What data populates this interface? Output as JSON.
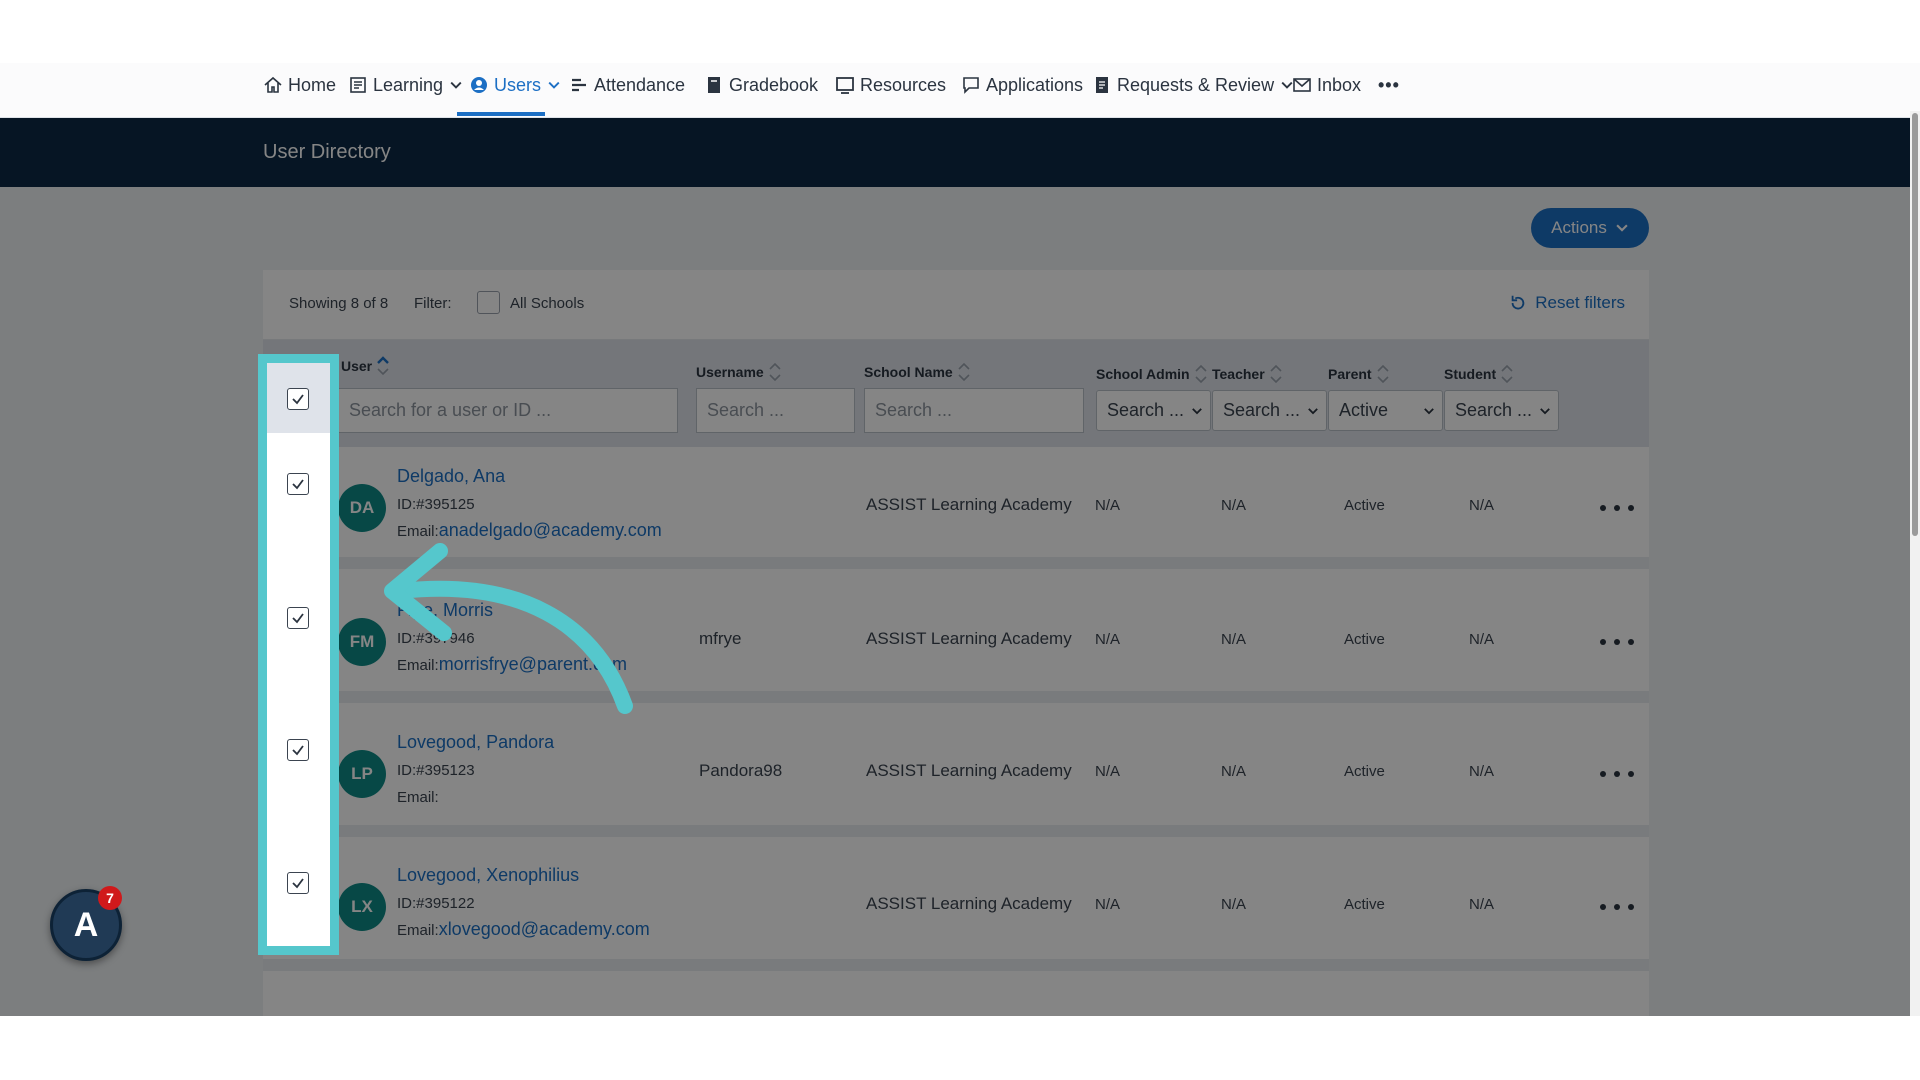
{
  "nav": {
    "items": [
      {
        "label": "Home",
        "icon": "home-icon"
      },
      {
        "label": "Learning",
        "icon": "learning-icon"
      },
      {
        "label": "Users",
        "icon": "user-icon"
      },
      {
        "label": "Attendance",
        "icon": "attendance-icon"
      },
      {
        "label": "Gradebook",
        "icon": "gradebook-icon"
      },
      {
        "label": "Resources",
        "icon": "resources-icon"
      },
      {
        "label": "Applications",
        "icon": "applications-icon"
      },
      {
        "label": "Requests & Review",
        "icon": "requests-icon"
      },
      {
        "label": "Inbox",
        "icon": "inbox-icon"
      }
    ],
    "more_label": "•••",
    "active": "Users"
  },
  "page": {
    "title": "User Directory"
  },
  "actions_label": "Actions",
  "filterbar": {
    "showing": "Showing 8 of 8",
    "filter_label": "Filter:",
    "all_schools": "All Schools",
    "reset": "Reset filters"
  },
  "table": {
    "columns": {
      "user": "User",
      "username": "Username",
      "school": "School Name",
      "school_admin": "School Admin",
      "teacher": "Teacher",
      "parent": "Parent",
      "student": "Student"
    },
    "search": {
      "user_placeholder": "Search for a user or ID ...",
      "username_placeholder": "Search ...",
      "school_placeholder": "Search ...",
      "school_admin": "Search ...",
      "teacher": "Search ...",
      "parent": "Active",
      "student": "Search ..."
    },
    "rows": [
      {
        "initials": "DA",
        "name": "Delgado, Ana",
        "id": "ID:#395125",
        "email_label": "Email:",
        "email": "anadelgado@academy.com",
        "username": "",
        "school": "ASSIST Learning Academy",
        "school_admin": "N/A",
        "teacher": "N/A",
        "parent": "Active",
        "student": "N/A",
        "checked": true
      },
      {
        "initials": "FM",
        "name": "Frye, Morris",
        "id": "ID:#397946",
        "email_label": "Email:",
        "email": "morrisfrye@parent.com",
        "username": "mfrye",
        "school": "ASSIST Learning Academy",
        "school_admin": "N/A",
        "teacher": "N/A",
        "parent": "Active",
        "student": "N/A",
        "checked": true
      },
      {
        "initials": "LP",
        "name": "Lovegood, Pandora",
        "id": "ID:#395123",
        "email_label": "Email:",
        "email": "",
        "username": "Pandora98",
        "school": "ASSIST Learning Academy",
        "school_admin": "N/A",
        "teacher": "N/A",
        "parent": "Active",
        "student": "N/A",
        "checked": true
      },
      {
        "initials": "LX",
        "name": "Lovegood, Xenophilius",
        "id": "ID:#395122",
        "email_label": "Email:",
        "email": "xlovegood@academy.com",
        "username": "",
        "school": "ASSIST Learning Academy",
        "school_admin": "N/A",
        "teacher": "N/A",
        "parent": "Active",
        "student": "N/A",
        "checked": true
      }
    ]
  },
  "badge": {
    "letter": "A",
    "count": "7"
  },
  "colors": {
    "accent": "#1c6fc4",
    "header": "#0c2a45",
    "highlight": "#55c7cc",
    "avatar": "#0e8b87"
  }
}
